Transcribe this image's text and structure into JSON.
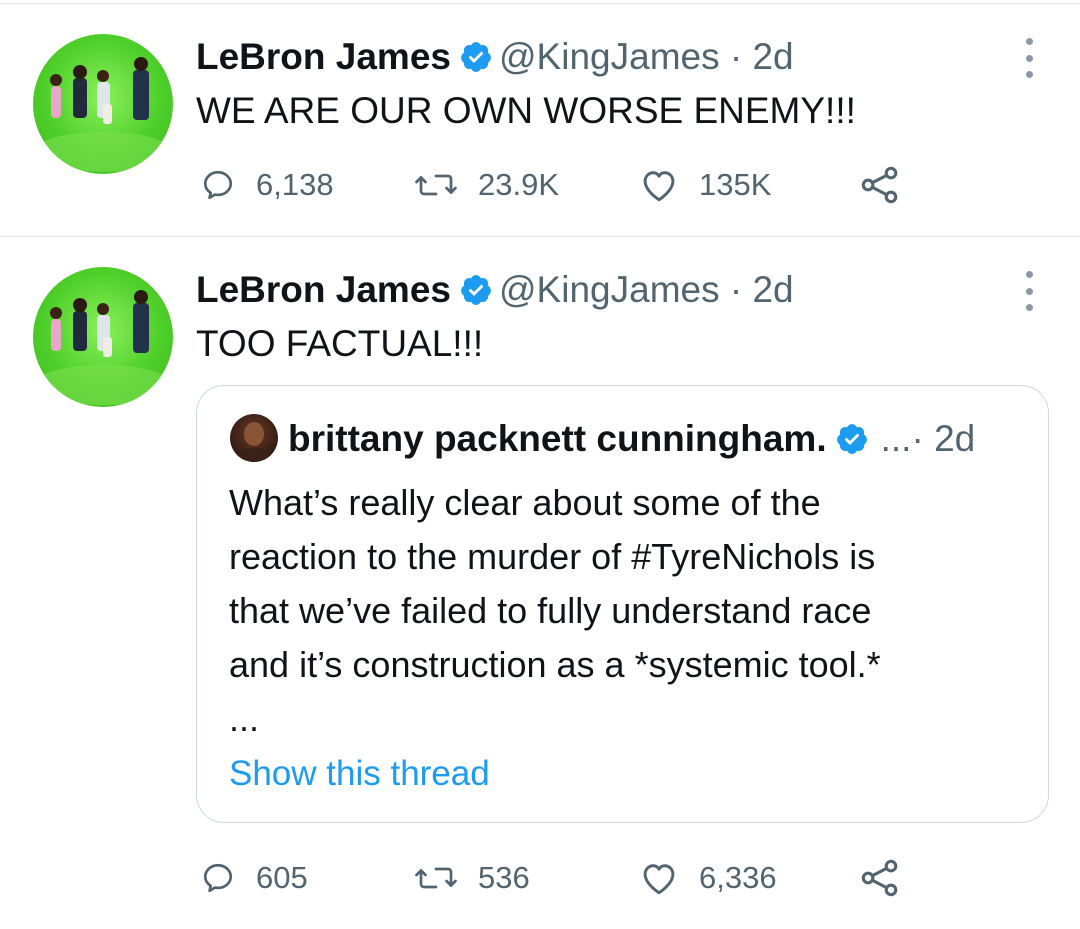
{
  "tweets": [
    {
      "author_name": "LeBron James",
      "handle_time": "@KingJames · 2d",
      "text": "WE ARE OUR OWN WORSE ENEMY!!!",
      "replies": "6,138",
      "retweets": "23.9K",
      "likes": "135K"
    },
    {
      "author_name": "LeBron James",
      "handle_time": "@KingJames · 2d",
      "text": "TOO FACTUAL!!!",
      "replies": "605",
      "retweets": "536",
      "likes": "6,336",
      "quoted": {
        "author_name": "brittany packnett cunningham.",
        "meta": "...· 2d",
        "lines": [
          "What’s really clear about some of the",
          "reaction to the murder of #TyreNichols is",
          "that we’ve failed to fully understand race",
          "and it’s construction as a *systemic tool.*",
          "..."
        ],
        "show_thread": "Show this thread"
      }
    }
  ],
  "colors": {
    "verified": "#1d9bf0",
    "link": "#1d9bf0",
    "muted_text": "#536471",
    "avatar_green": "#4fcf2a"
  },
  "icons": [
    "reply-icon",
    "retweet-icon",
    "like-icon",
    "share-icon",
    "more-icon",
    "verified-badge-icon"
  ]
}
